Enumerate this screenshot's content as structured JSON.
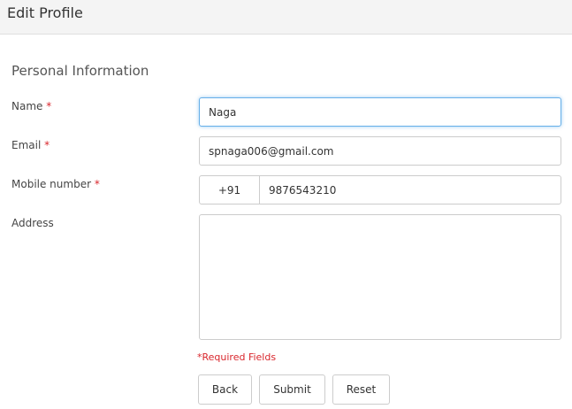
{
  "header": {
    "title": "Edit Profile"
  },
  "section": {
    "title": "Personal Information"
  },
  "form": {
    "name": {
      "label": "Name",
      "required_mark": "*",
      "value": "Naga"
    },
    "email": {
      "label": "Email",
      "required_mark": "*",
      "value": "spnaga006@gmail.com"
    },
    "mobile": {
      "label": "Mobile number",
      "required_mark": "*",
      "country_code": "+91",
      "value": "9876543210"
    },
    "address": {
      "label": "Address",
      "value": ""
    },
    "required_note": "*Required Fields"
  },
  "buttons": {
    "back": "Back",
    "submit": "Submit",
    "reset": "Reset"
  },
  "colors": {
    "required": "#d9262c",
    "focus_border": "#66afe9",
    "header_bg": "#f4f4f4"
  }
}
